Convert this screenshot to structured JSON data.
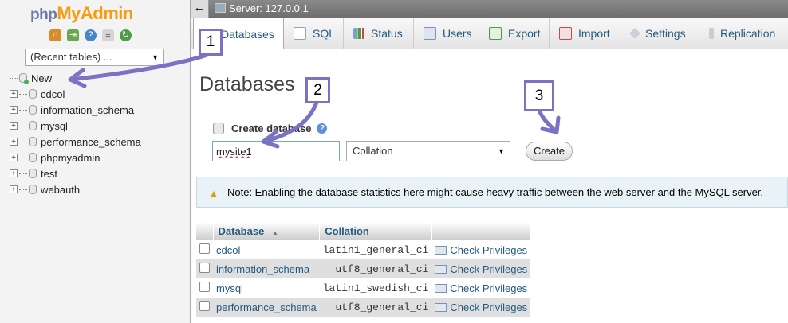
{
  "logo": {
    "part1": "php",
    "part2": "MyAdmin"
  },
  "nav_icons": [
    "home-icon",
    "logout-icon",
    "help-icon",
    "docs-icon",
    "reload-icon"
  ],
  "recent_tables": "(Recent tables) ...",
  "tree": {
    "new_label": "New",
    "databases": [
      "cdcol",
      "information_schema",
      "mysql",
      "performance_schema",
      "phpmyadmin",
      "test",
      "webauth"
    ]
  },
  "server_bar": {
    "back": "←",
    "text": "Server: 127.0.0.1"
  },
  "tabs": [
    {
      "label": "Databases",
      "icon": "databases-icon",
      "color": "#4a7fb5"
    },
    {
      "label": "SQL",
      "icon": "sql-icon",
      "color": "#8aa4c4"
    },
    {
      "label": "Status",
      "icon": "status-icon",
      "color": "#7aa2c8"
    },
    {
      "label": "Users",
      "icon": "users-icon",
      "color": "#7a95b8"
    },
    {
      "label": "Export",
      "icon": "export-icon",
      "color": "#4e9a48"
    },
    {
      "label": "Import",
      "icon": "import-icon",
      "color": "#c44a4a"
    },
    {
      "label": "Settings",
      "icon": "settings-icon",
      "color": "#7e8fa3"
    },
    {
      "label": "Replication",
      "icon": "replication-icon",
      "color": "#999999"
    }
  ],
  "main": {
    "heading": "Databases",
    "create_label": "Create database",
    "db_name_value": "mysite1",
    "collation_value": "Collation",
    "create_button": "Create",
    "notice": "Note: Enabling the database statistics here might cause heavy traffic between the web server and the MySQL server."
  },
  "table": {
    "headers": {
      "database": "Database",
      "sort": "▲",
      "collation": "Collation"
    },
    "rows": [
      {
        "name": "cdcol",
        "collation": "latin1_general_ci",
        "action": "Check Privileges"
      },
      {
        "name": "information_schema",
        "collation": "utf8_general_ci",
        "action": "Check Privileges"
      },
      {
        "name": "mysql",
        "collation": "latin1_swedish_ci",
        "action": "Check Privileges"
      },
      {
        "name": "performance_schema",
        "collation": "utf8_general_ci",
        "action": "Check Privileges"
      }
    ]
  },
  "annotations": {
    "one": "1",
    "two": "2",
    "three": "3",
    "color": "#7a73c4"
  }
}
